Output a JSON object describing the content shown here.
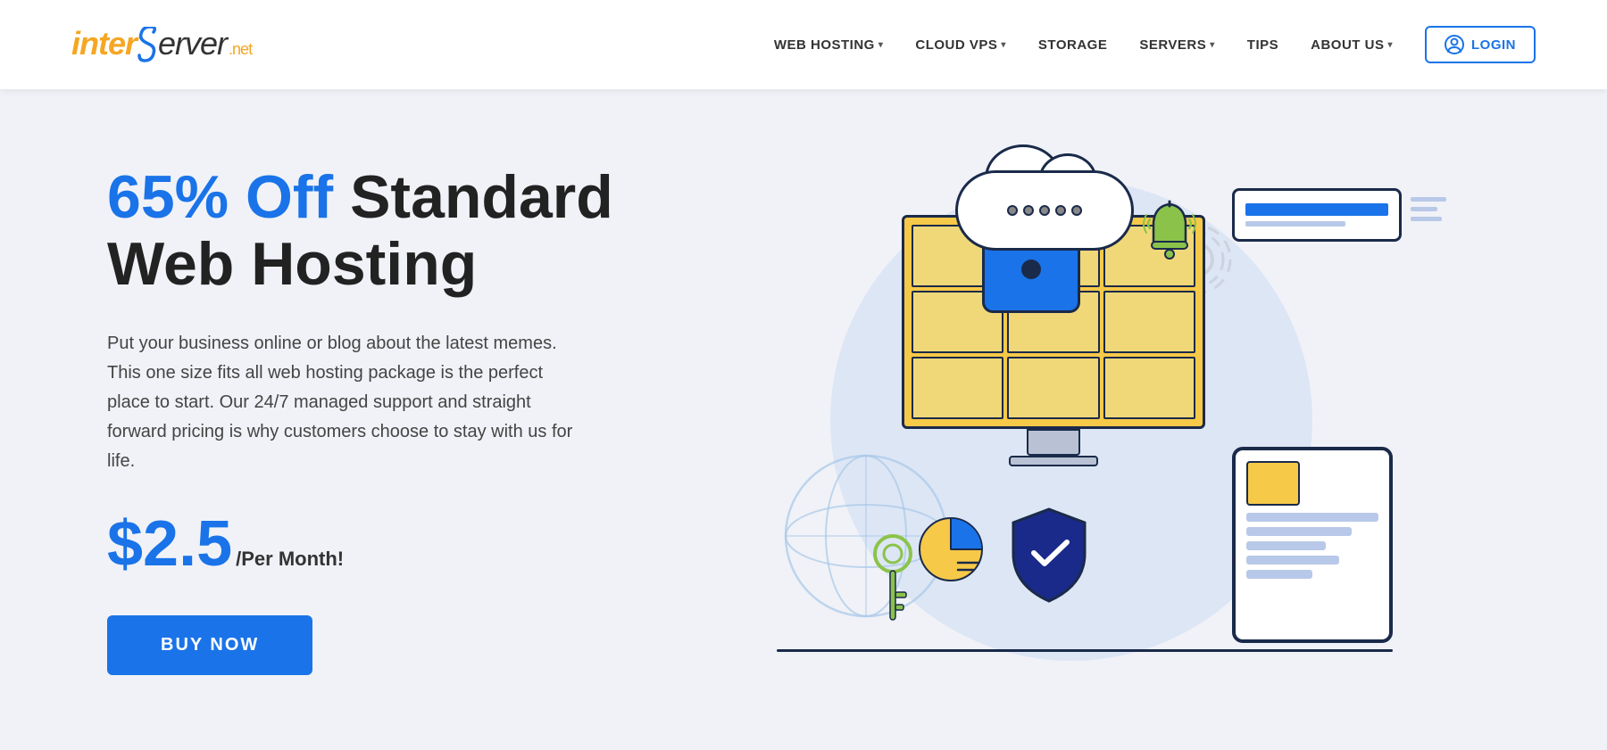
{
  "brand": {
    "name_part1": "inter",
    "name_s": "S",
    "name_part2": "erver",
    "name_ext": ".net"
  },
  "nav": {
    "items": [
      {
        "id": "web-hosting",
        "label": "WEB HOSTING",
        "hasDropdown": true
      },
      {
        "id": "cloud-vps",
        "label": "CLOUD VPS",
        "hasDropdown": true
      },
      {
        "id": "storage",
        "label": "STORAGE",
        "hasDropdown": false
      },
      {
        "id": "servers",
        "label": "SERVERS",
        "hasDropdown": true
      },
      {
        "id": "tips",
        "label": "TIPS",
        "hasDropdown": false
      },
      {
        "id": "about-us",
        "label": "ABOUT US",
        "hasDropdown": true
      }
    ],
    "login_label": "LOGIN"
  },
  "hero": {
    "title_highlight": "65% Off",
    "title_rest": " Standard\nWeb Hosting",
    "description": "Put your business online or blog about the latest memes. This one size fits all web hosting package is the perfect place to start. Our 24/7 managed support and straight forward pricing is why customers choose to stay with us for life.",
    "price": "$2.5",
    "price_suffix": "/Per Month!",
    "cta_label": "BUY NOW"
  },
  "colors": {
    "accent_blue": "#1a73e8",
    "dark_navy": "#1a2a4a",
    "yellow": "#f7c948",
    "green": "#8bc34a",
    "bg": "#f0f2f7",
    "white": "#ffffff"
  }
}
